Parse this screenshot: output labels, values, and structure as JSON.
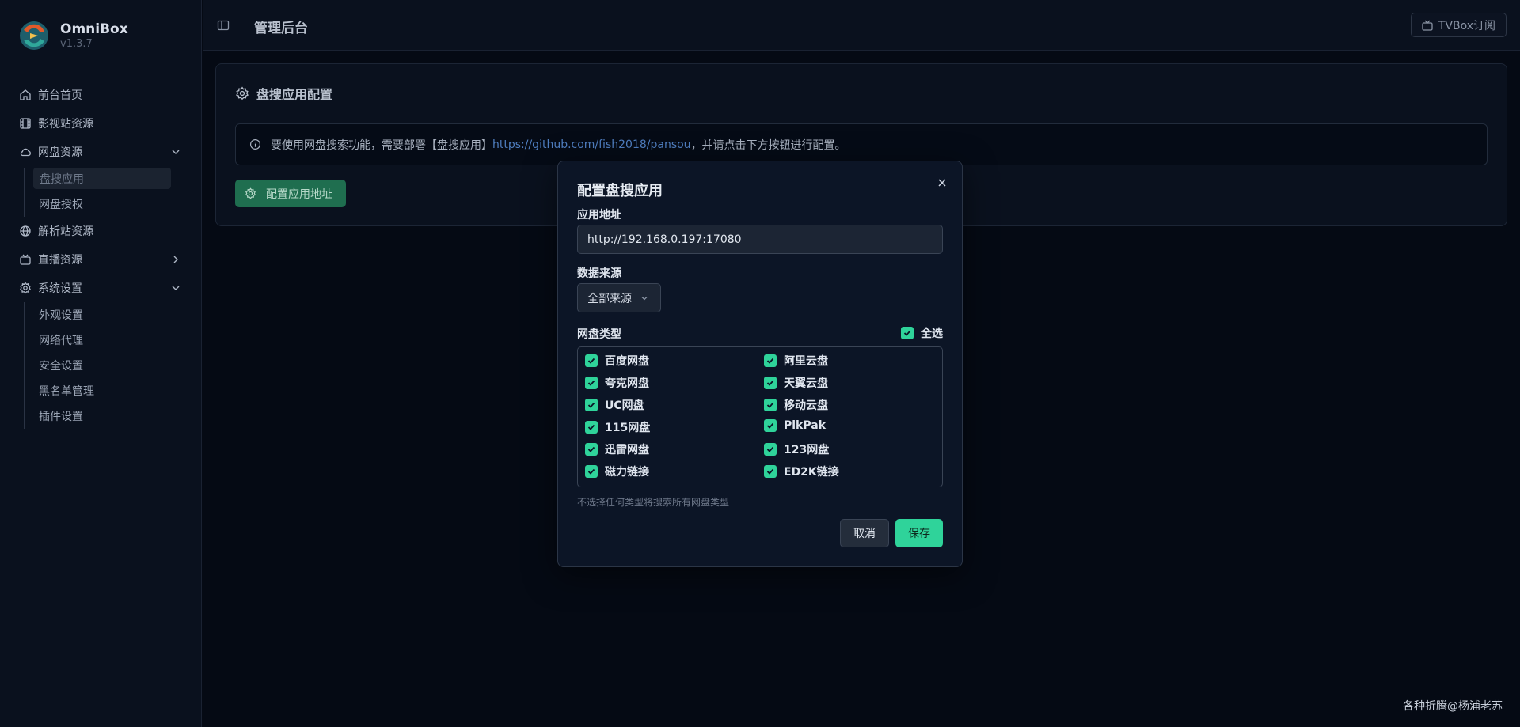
{
  "brand": {
    "name": "OmniBox",
    "version": "v1.3.7"
  },
  "sidebar": {
    "items": [
      {
        "label": "前台首页",
        "icon": "home-icon"
      },
      {
        "label": "影视站资源",
        "icon": "film-icon"
      },
      {
        "label": "网盘资源",
        "icon": "cloud-icon",
        "expanded": true,
        "children": [
          {
            "label": "盘搜应用",
            "active": true
          },
          {
            "label": "网盘授权"
          }
        ]
      },
      {
        "label": "解析站资源",
        "icon": "globe-icon"
      },
      {
        "label": "直播资源",
        "icon": "tv-icon",
        "expanded": false
      },
      {
        "label": "系统设置",
        "icon": "gear-icon",
        "expanded": true,
        "children": [
          {
            "label": "外观设置"
          },
          {
            "label": "网络代理"
          },
          {
            "label": "安全设置"
          },
          {
            "label": "黑名单管理"
          },
          {
            "label": "插件设置"
          }
        ]
      }
    ]
  },
  "header": {
    "title": "管理后台",
    "tvbox_label": "TVBox订阅"
  },
  "card": {
    "title": "盘搜应用配置",
    "alert_prefix": "要使用网盘搜索功能，需要部署【盘搜应用】",
    "alert_link": "https://github.com/fish2018/pansou",
    "alert_suffix": "，并请点击下方按钮进行配置。",
    "config_button": "配置应用地址"
  },
  "modal": {
    "title": "配置盘搜应用",
    "url_label": "应用地址",
    "url_value": "http://192.168.0.197:17080",
    "source_label": "数据来源",
    "source_value": "全部来源",
    "types_label": "网盘类型",
    "select_all": "全选",
    "types": [
      "百度网盘",
      "阿里云盘",
      "夸克网盘",
      "天翼云盘",
      "UC网盘",
      "移动云盘",
      "115网盘",
      "PikPak",
      "迅雷网盘",
      "123网盘",
      "磁力链接",
      "ED2K链接"
    ],
    "hint": "不选择任何类型将搜索所有网盘类型",
    "cancel": "取消",
    "save": "保存"
  },
  "watermark": "各种折腾@杨浦老苏",
  "colors": {
    "accent": "#2fd39a",
    "background": "#050a14",
    "link": "#4f7ec0"
  }
}
